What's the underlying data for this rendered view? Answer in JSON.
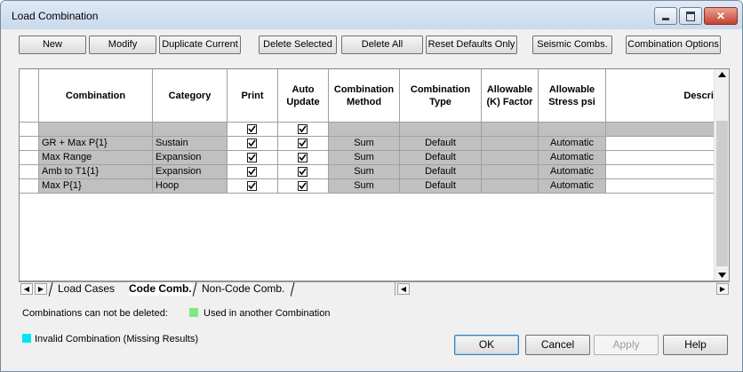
{
  "window": {
    "title": "Load Combination"
  },
  "toolbar": {
    "new": "New",
    "modify": "Modify",
    "duplicate": "Duplicate Current",
    "delete_selected": "Delete Selected",
    "delete_all": "Delete All",
    "reset_defaults": "Reset Defaults Only",
    "seismic": "Seismic Combs.",
    "options": "Combination Options"
  },
  "grid": {
    "headers": {
      "combination": "Combination",
      "category": "Category",
      "print": "Print",
      "auto_update": "Auto Update",
      "method": "Combination Method",
      "type": "Combination Type",
      "k_factor": "Allowable (K) Factor",
      "stress": "Allowable Stress psi",
      "description": "Descri"
    },
    "rows": [
      {
        "combination": "GR + Max P{1}",
        "category": "Sustain",
        "method": "Sum",
        "type": "Default",
        "stress": "Automatic"
      },
      {
        "combination": "Max Range",
        "category": "Expansion",
        "method": "Sum",
        "type": "Default",
        "stress": "Automatic"
      },
      {
        "combination": "Amb to T1{1}",
        "category": "Expansion",
        "method": "Sum",
        "type": "Default",
        "stress": "Automatic"
      },
      {
        "combination": "Max P{1}",
        "category": "Hoop",
        "method": "Sum",
        "type": "Default",
        "stress": "Automatic"
      }
    ]
  },
  "tabs": {
    "load_cases": "Load Cases",
    "code_comb": "Code Comb.",
    "non_code_comb": "Non-Code Comb."
  },
  "legend": {
    "note": "Combinations can not be deleted:",
    "used": "Used in another Combination",
    "invalid": "Invalid Combination (Missing Results)",
    "used_color": "#80ea80",
    "invalid_color": "#00e4f4"
  },
  "dialog": {
    "ok": "OK",
    "cancel": "Cancel",
    "apply": "Apply",
    "help": "Help"
  }
}
